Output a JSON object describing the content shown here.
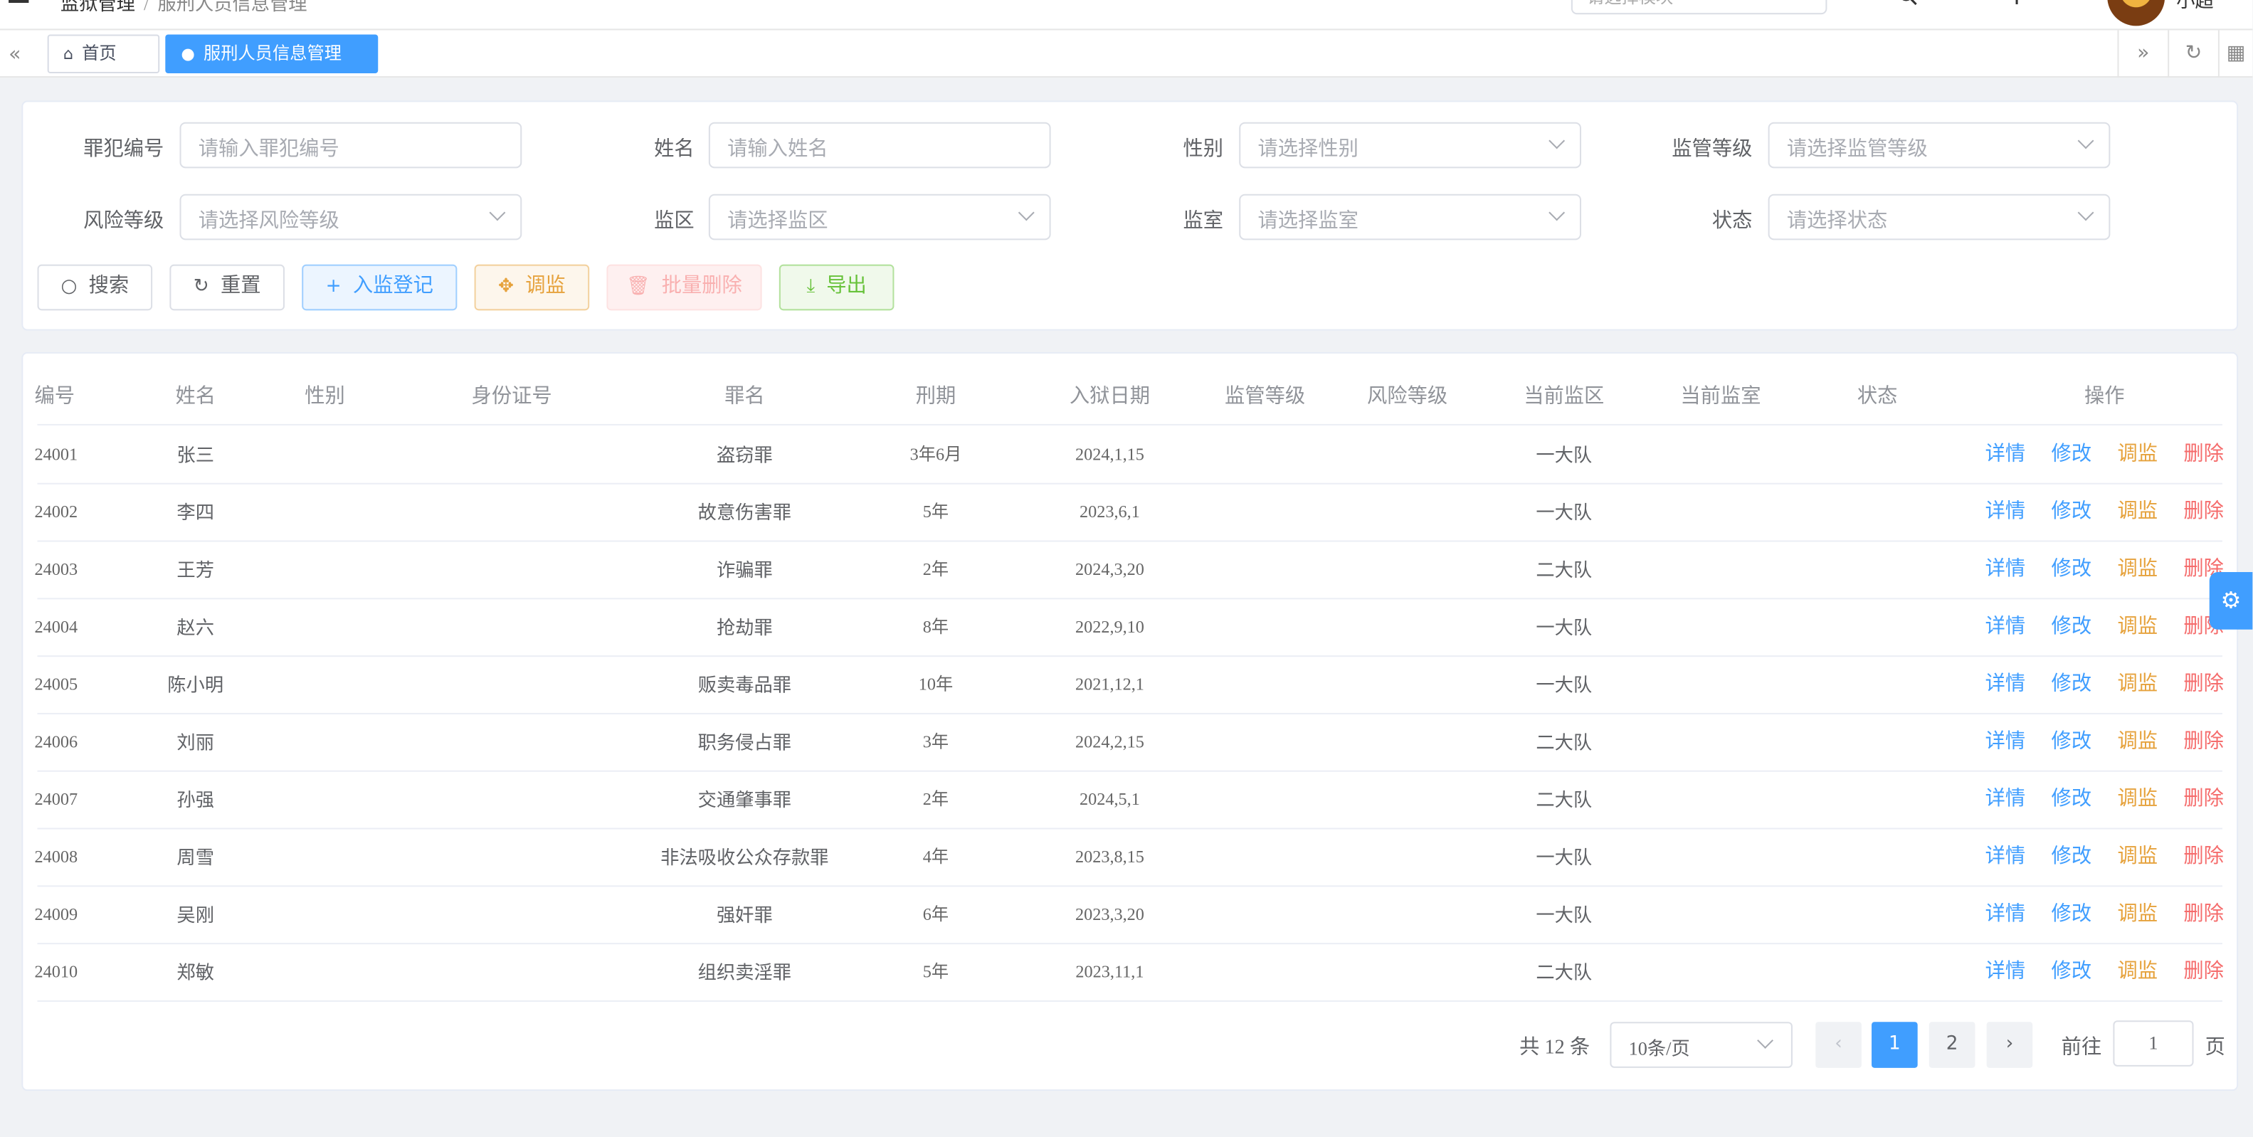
{
  "navbar": {
    "breadcrumb": [
      "监狱管理",
      "服刑人员信息管理"
    ],
    "search_placeholder": "请选择模块",
    "username": "小超"
  },
  "tags": {
    "home": "首页",
    "active": "服刑人员信息管理"
  },
  "search": {
    "fields": [
      {
        "label": "罪犯编号",
        "placeholder": "请输入罪犯编号",
        "type": "input"
      },
      {
        "label": "姓名",
        "placeholder": "请输入姓名",
        "type": "input"
      },
      {
        "label": "性别",
        "placeholder": "请选择性别",
        "type": "select"
      },
      {
        "label": "监管等级",
        "placeholder": "请选择监管等级",
        "type": "select"
      },
      {
        "label": "风险等级",
        "placeholder": "请选择风险等级",
        "type": "select"
      },
      {
        "label": "监区",
        "placeholder": "请选择监区",
        "type": "select"
      },
      {
        "label": "监室",
        "placeholder": "请选择监室",
        "type": "select"
      },
      {
        "label": "状态",
        "placeholder": "请选择状态",
        "type": "select"
      }
    ],
    "buttons": {
      "search": "搜索",
      "reset": "重置",
      "register": "入监登记",
      "transfer": "调监",
      "batch_delete": "批量删除",
      "export": "导出"
    }
  },
  "table": {
    "headers": [
      "编号",
      "姓名",
      "性别",
      "身份证号",
      "罪名",
      "刑期",
      "入狱日期",
      "监管等级",
      "风险等级",
      "当前监区",
      "当前监室",
      "状态",
      "操作"
    ],
    "rows": [
      {
        "id": "24001",
        "name": "张三",
        "crime": "盗窃罪",
        "term": "3年6月",
        "date": "2024,1,15",
        "area": "一大队"
      },
      {
        "id": "24002",
        "name": "李四",
        "crime": "故意伤害罪",
        "term": "5年",
        "date": "2023,6,1",
        "area": "一大队"
      },
      {
        "id": "24003",
        "name": "王芳",
        "crime": "诈骗罪",
        "term": "2年",
        "date": "2024,3,20",
        "area": "二大队"
      },
      {
        "id": "24004",
        "name": "赵六",
        "crime": "抢劫罪",
        "term": "8年",
        "date": "2022,9,10",
        "area": "一大队"
      },
      {
        "id": "24005",
        "name": "陈小明",
        "crime": "贩卖毒品罪",
        "term": "10年",
        "date": "2021,12,1",
        "area": "一大队"
      },
      {
        "id": "24006",
        "name": "刘丽",
        "crime": "职务侵占罪",
        "term": "3年",
        "date": "2024,2,15",
        "area": "二大队"
      },
      {
        "id": "24007",
        "name": "孙强",
        "crime": "交通肇事罪",
        "term": "2年",
        "date": "2024,5,1",
        "area": "二大队"
      },
      {
        "id": "24008",
        "name": "周雪",
        "crime": "非法吸收公众存款罪",
        "term": "4年",
        "date": "2023,8,15",
        "area": "一大队"
      },
      {
        "id": "24009",
        "name": "吴刚",
        "crime": "强奸罪",
        "term": "6年",
        "date": "2023,3,20",
        "area": "一大队"
      },
      {
        "id": "24010",
        "name": "郑敏",
        "crime": "组织卖淫罪",
        "term": "5年",
        "date": "2023,11,1",
        "area": "二大队"
      }
    ],
    "actions": {
      "detail": "详情",
      "edit": "修改",
      "transfer": "调监",
      "delete": "删除"
    }
  },
  "pagination": {
    "total": "共 12 条",
    "page_size": "10条/页",
    "pages": [
      "1",
      "2"
    ],
    "current": "1",
    "goto_label": "前往",
    "goto_value": "1",
    "page_unit": "页"
  },
  "colors": {
    "primary": "#409eff",
    "warning": "#e6a23c",
    "danger": "#f56c6c",
    "success": "#67c23a"
  }
}
